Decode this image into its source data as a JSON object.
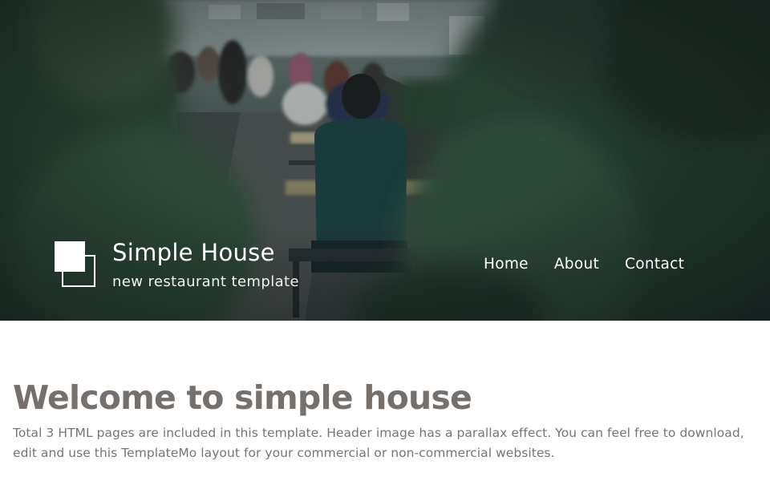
{
  "header": {
    "brand_title": "Simple House",
    "brand_tagline": "new restaurant template",
    "nav": [
      {
        "label": "Home"
      },
      {
        "label": "About"
      },
      {
        "label": "Contact"
      }
    ],
    "hero_image": "restaurant-patio-photo"
  },
  "main": {
    "title": "Welcome to simple house",
    "body": "Total 3 HTML pages are included in this template. Header image has a parallax effect. You can feel free to download, edit and use this TemplateMo layout for your commercial or non-commercial websites."
  },
  "colors": {
    "heading": "#76706d",
    "body_text": "#7a7471",
    "hero_overlay": "#1f2e2c",
    "foliage": "#3d5a45"
  }
}
